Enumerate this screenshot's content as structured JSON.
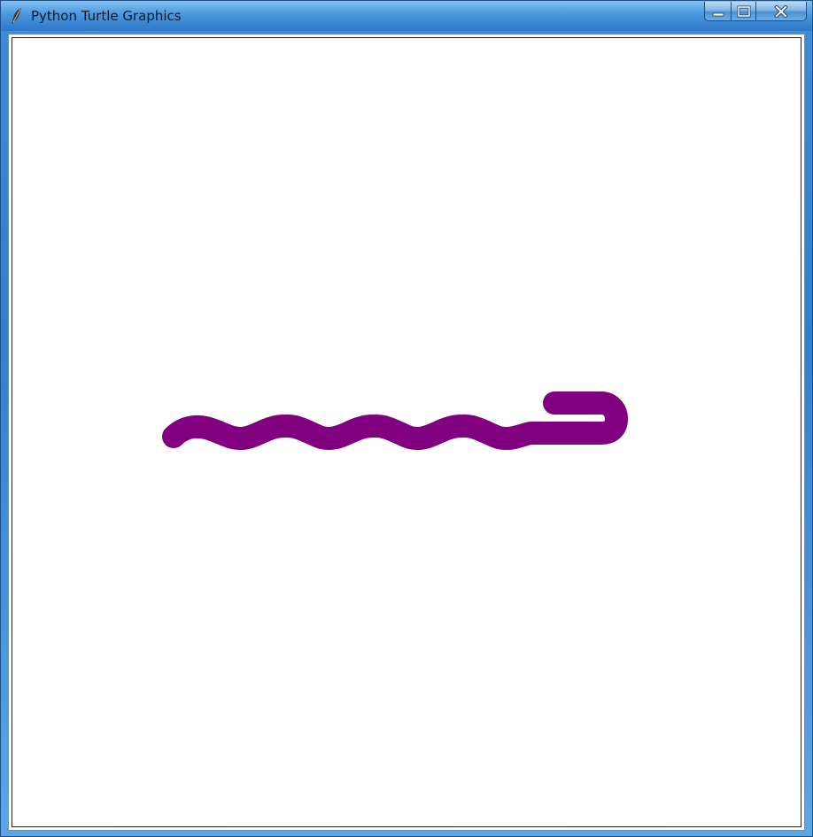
{
  "window": {
    "title": "Python Turtle Graphics",
    "icon": "feather-icon"
  },
  "caption_buttons": {
    "minimize_icon": "minimize-icon",
    "maximize_icon": "maximize-icon",
    "close_icon": "close-icon"
  },
  "drawing": {
    "pen_color": "#800080",
    "background_color": "#ffffff"
  }
}
